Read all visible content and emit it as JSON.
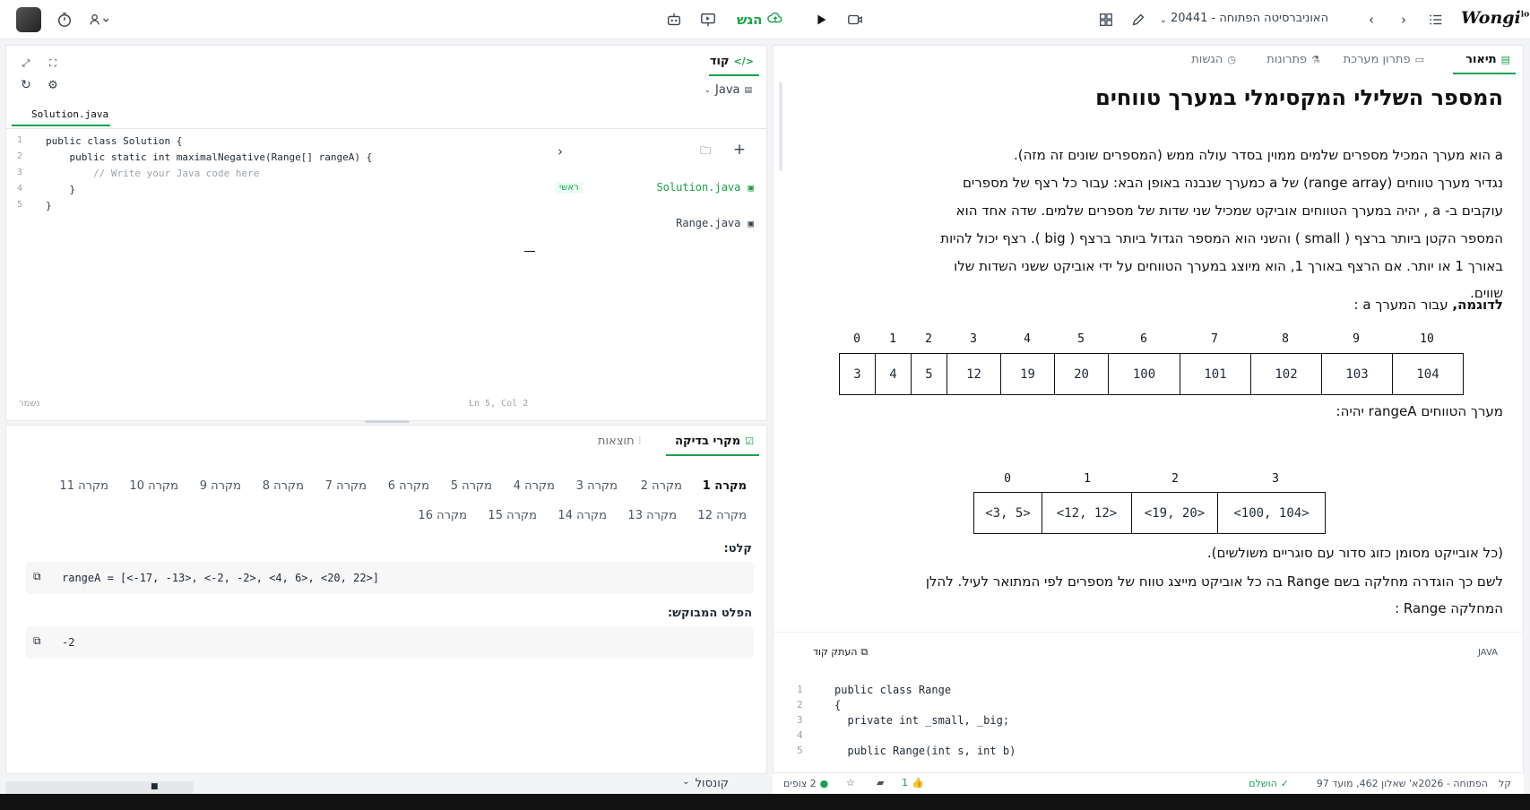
{
  "topbar": {
    "submit_label": "הגש",
    "course_title": "האוניברסיטה הפתוחה - 20441",
    "logo": "Wongi",
    "logo_sup": "io"
  },
  "code_panel": {
    "tab_label": "קוד",
    "language": "Java",
    "file_tab": "Solution.java",
    "code_lines": [
      "public class Solution {",
      "    public static int maximalNegative(Range[] rangeA) {",
      "        // Write your Java code here",
      "    }",
      "}"
    ],
    "line_numbers": [
      "1",
      "2",
      "3",
      "4",
      "5"
    ],
    "files": [
      {
        "name": "Solution.java",
        "badge": "ראשי"
      },
      {
        "name": "Range.java",
        "badge": ""
      }
    ],
    "status_left": "נשמר",
    "status_pos": "Ln 5, Col 2"
  },
  "test_panel": {
    "tabs": [
      "מקרי בדיקה",
      "תוצאות"
    ],
    "cases_row1": [
      "מקרה 1",
      "מקרה 2",
      "מקרה 3",
      "מקרה 4",
      "מקרה 5",
      "מקרה 6",
      "מקרה 7",
      "מקרה 8",
      "מקרה 9",
      "מקרה 10",
      "מקרה 11"
    ],
    "cases_row2": [
      "מקרה 12",
      "מקרה 13",
      "מקרה 14",
      "מקרה 15",
      "מקרה 16"
    ],
    "input_label": "קלט:",
    "input_value": "rangeA = [<-17, -13>, <-2, -2>, <4, 6>, <20, 22>]",
    "expected_label": "הפלט המבוקש:",
    "expected_value": "-2",
    "console_label": "קונסול"
  },
  "desc_panel": {
    "tabs": [
      "תיאור",
      "פתרון מערכת",
      "פתרונות",
      "הגשות"
    ],
    "title": "המספר השלילי המקסימלי במערך טווחים",
    "para_lines": [
      "a  הוא מערך המכיל מספרים שלמים ממוין בסדר עולה ממש (המספרים שונים זה מזה).",
      "נגדיר מערך טווחים (range array) של  a  כמערך שנבנה באופן הבא: עבור כל רצף של מספרים",
      "עוקבים ב- a , יהיה במערך הטווחים אוביקט שמכיל שני שדות של מספרים שלמים. שדה אחד הוא",
      "המספר הקטן ביותר ברצף ( small ) והשני הוא המספר הגדול ביותר ברצף ( big ). רצף יכול להיות",
      "באורך 1 או יותר. אם הרצף באורך 1, הוא מיוצג במערך הטווחים על ידי אוביקט ששני השדות שלו",
      "שווים."
    ],
    "example_label": "לדוגמה,",
    "example_rest": " עבור המערך  a :",
    "array_a_indices": [
      "0",
      "1",
      "2",
      "3",
      "4",
      "5",
      "6",
      "7",
      "8",
      "9",
      "10"
    ],
    "array_a_values": [
      "3",
      "4",
      "5",
      "12",
      "19",
      "20",
      "100",
      "101",
      "102",
      "103",
      "104"
    ],
    "range_label": "מערך הטווחים  rangeA  יהיה:",
    "range_indices": [
      "0",
      "1",
      "2",
      "3"
    ],
    "range_values": [
      "<3, 5>",
      "<12, 12>",
      "<19, 20>",
      "<100, 104>"
    ],
    "note": "(כל אובייקט מסומן כזוג סדור עם סוגריים משולשים).",
    "class_line1": "לשם כך הוגדרה מחלקה בשם  Range  בה כל אוביקט מייצג טווח של מספרים לפי המתואר לעיל. להלן",
    "class_line2": "המחלקה  Range :",
    "copy_code": "העתק קוד",
    "code_lang": "JAVA",
    "code_lines": [
      "public class Range",
      "{",
      "  private int _small, _big;",
      "",
      "  public Range(int s, int b)"
    ],
    "code_line_numbers": [
      "1",
      "2",
      "3",
      "4",
      "5"
    ]
  },
  "statusbar": {
    "left_label": "קל",
    "course_info": "הפתוחה - 2026א' שאלון 462, מועד 97",
    "done_label": "הושלם",
    "likes": "1",
    "viewers": "2 צופים"
  }
}
